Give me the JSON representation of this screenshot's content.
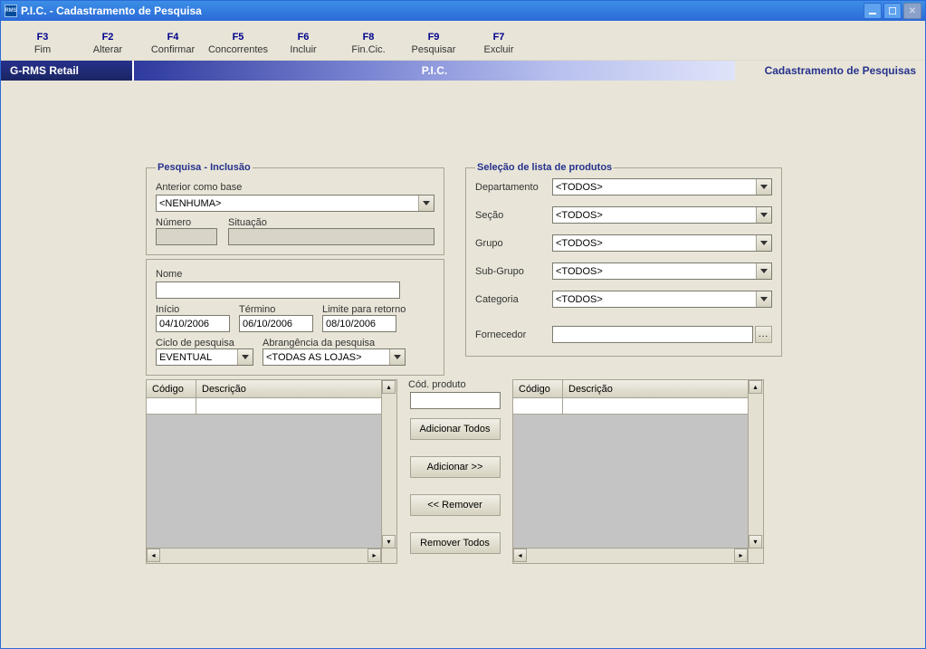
{
  "window": {
    "title": "P.I.C.  -  Cadastramento de Pesquisa"
  },
  "toolbar": [
    {
      "key": "F3",
      "label": "Fim"
    },
    {
      "key": "F2",
      "label": "Alterar"
    },
    {
      "key": "F4",
      "label": "Confirmar"
    },
    {
      "key": "F5",
      "label": "Concorrentes"
    },
    {
      "key": "F6",
      "label": "Incluir"
    },
    {
      "key": "F8",
      "label": "Fin.Cic."
    },
    {
      "key": "F9",
      "label": "Pesquisar"
    },
    {
      "key": "F7",
      "label": "Excluir"
    }
  ],
  "ribbon": {
    "left": "G-RMS Retail",
    "mid": "P.I.C.",
    "right": "Cadastramento de Pesquisas"
  },
  "pesquisa": {
    "legend": "Pesquisa - Inclusão",
    "anterior_label": "Anterior como base",
    "anterior_value": "<NENHUMA>",
    "numero_label": "Número",
    "numero_value": "",
    "situacao_label": "Situação",
    "situacao_value": "",
    "nome_label": "Nome",
    "nome_value": "",
    "inicio_label": "Início",
    "inicio_value": "04/10/2006",
    "termino_label": "Término",
    "termino_value": "06/10/2006",
    "limite_label": "Limite para retorno",
    "limite_value": "08/10/2006",
    "ciclo_label": "Ciclo de pesquisa",
    "ciclo_value": "EVENTUAL",
    "abrang_label": "Abrangência da pesquisa",
    "abrang_value": "<TODAS AS LOJAS>"
  },
  "selecao": {
    "legend": "Seleção de lista de produtos",
    "departamento_label": "Departamento",
    "departamento_value": "<TODOS>",
    "secao_label": "Seção",
    "secao_value": "<TODOS>",
    "grupo_label": "Grupo",
    "grupo_value": "<TODOS>",
    "subgrupo_label": "Sub-Grupo",
    "subgrupo_value": "<TODOS>",
    "categoria_label": "Categoria",
    "categoria_value": "<TODOS>",
    "fornecedor_label": "Fornecedor",
    "fornecedor_value": ""
  },
  "grid_headers": {
    "codigo": "Código",
    "descricao": "Descrição"
  },
  "mid": {
    "cod_label": "Cód. produto",
    "add_all": "Adicionar Todos",
    "add": "Adicionar >>",
    "remove": "<< Remover",
    "remove_all": "Remover Todos"
  }
}
